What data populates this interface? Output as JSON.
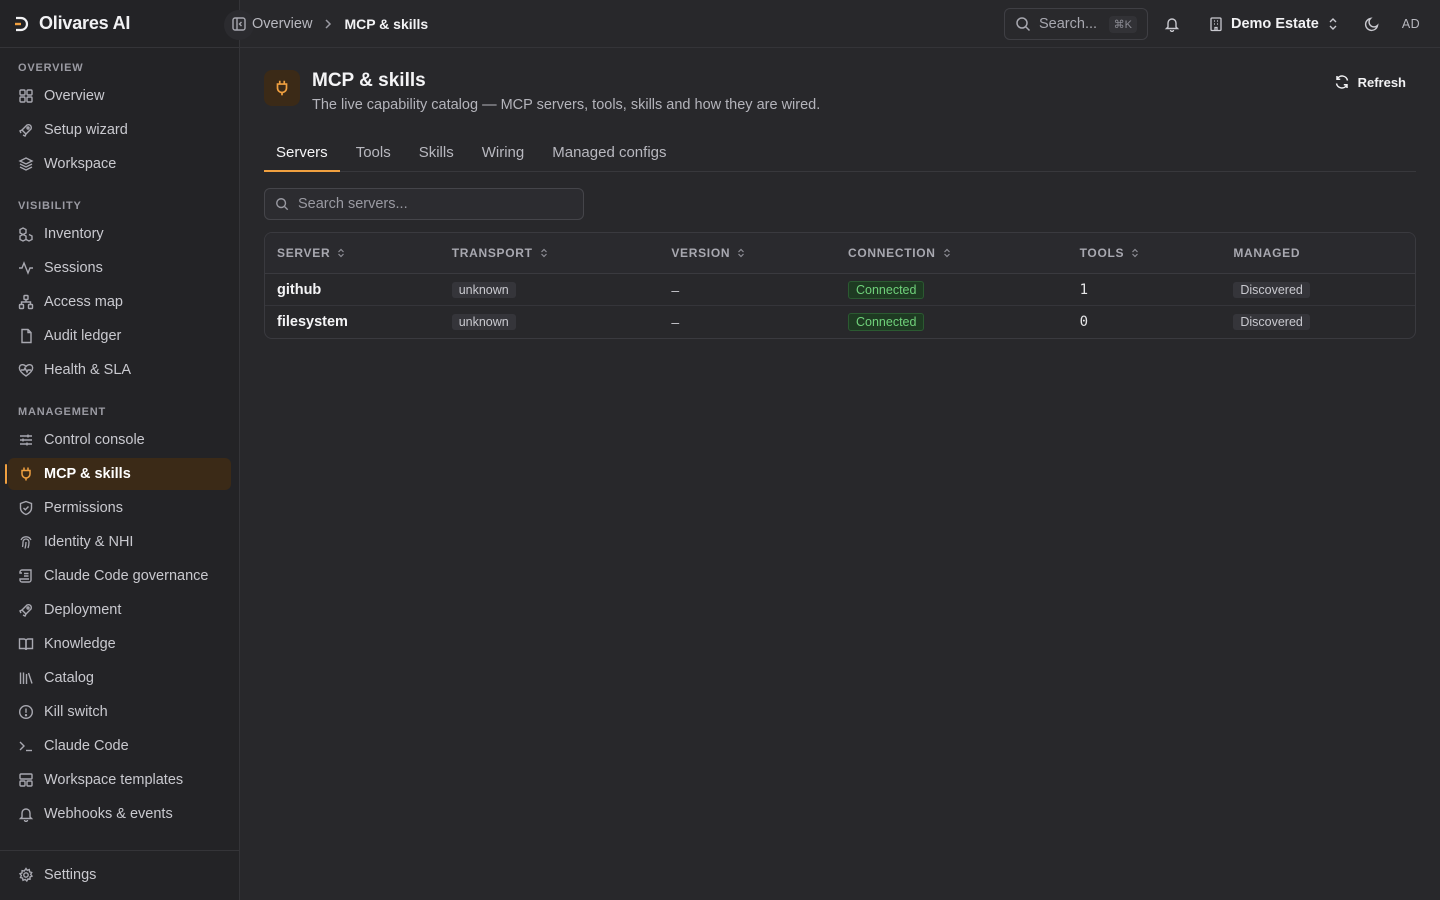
{
  "brand": {
    "name": "Olivares AI"
  },
  "sidebar": {
    "groups": [
      {
        "label": "OVERVIEW",
        "items": [
          {
            "label": "Overview",
            "icon": "grid-icon"
          },
          {
            "label": "Setup wizard",
            "icon": "rocket-icon"
          },
          {
            "label": "Workspace",
            "icon": "layers-icon"
          }
        ]
      },
      {
        "label": "VISIBILITY",
        "items": [
          {
            "label": "Inventory",
            "icon": "boxes-icon"
          },
          {
            "label": "Sessions",
            "icon": "activity-icon"
          },
          {
            "label": "Access map",
            "icon": "network-icon"
          },
          {
            "label": "Audit ledger",
            "icon": "file-icon"
          },
          {
            "label": "Health & SLA",
            "icon": "heart-pulse-icon"
          }
        ]
      },
      {
        "label": "MANAGEMENT",
        "items": [
          {
            "label": "Control console",
            "icon": "sliders-icon"
          },
          {
            "label": "MCP & skills",
            "icon": "plug-icon",
            "active": true
          },
          {
            "label": "Permissions",
            "icon": "shield-check-icon"
          },
          {
            "label": "Identity & NHI",
            "icon": "fingerprint-icon"
          },
          {
            "label": "Claude Code governance",
            "icon": "scroll-icon"
          },
          {
            "label": "Deployment",
            "icon": "rocket-icon"
          },
          {
            "label": "Knowledge",
            "icon": "book-icon"
          },
          {
            "label": "Catalog",
            "icon": "library-icon"
          },
          {
            "label": "Kill switch",
            "icon": "alert-circle-icon"
          },
          {
            "label": "Claude Code",
            "icon": "terminal-icon"
          },
          {
            "label": "Workspace templates",
            "icon": "layout-icon"
          },
          {
            "label": "Webhooks & events",
            "icon": "bell-icon"
          }
        ]
      }
    ],
    "footer": {
      "label": "Settings",
      "icon": "gear-icon"
    }
  },
  "topbar": {
    "breadcrumb": [
      "Overview",
      "MCP & skills"
    ],
    "search_placeholder": "Search...",
    "search_shortcut": "⌘K",
    "tenant": "Demo Estate",
    "avatar": "AD"
  },
  "page": {
    "title": "MCP & skills",
    "subtitle": "The live capability catalog — MCP servers, tools, skills and how they are wired.",
    "refresh_label": "Refresh",
    "tabs": [
      "Servers",
      "Tools",
      "Skills",
      "Wiring",
      "Managed configs"
    ],
    "active_tab": 0,
    "filter_placeholder": "Search servers..."
  },
  "table": {
    "columns": [
      "SERVER",
      "TRANSPORT",
      "VERSION",
      "CONNECTION",
      "TOOLS",
      "MANAGED"
    ],
    "rows": [
      {
        "server": "github",
        "transport": "unknown",
        "version": "–",
        "connection": "Connected",
        "tools": "1",
        "managed": "Discovered"
      },
      {
        "server": "filesystem",
        "transport": "unknown",
        "version": "–",
        "connection": "Connected",
        "tools": "0",
        "managed": "Discovered"
      }
    ]
  },
  "colors": {
    "accent": "#f0a040",
    "success": "#6fd07a",
    "background": "#28282b"
  }
}
